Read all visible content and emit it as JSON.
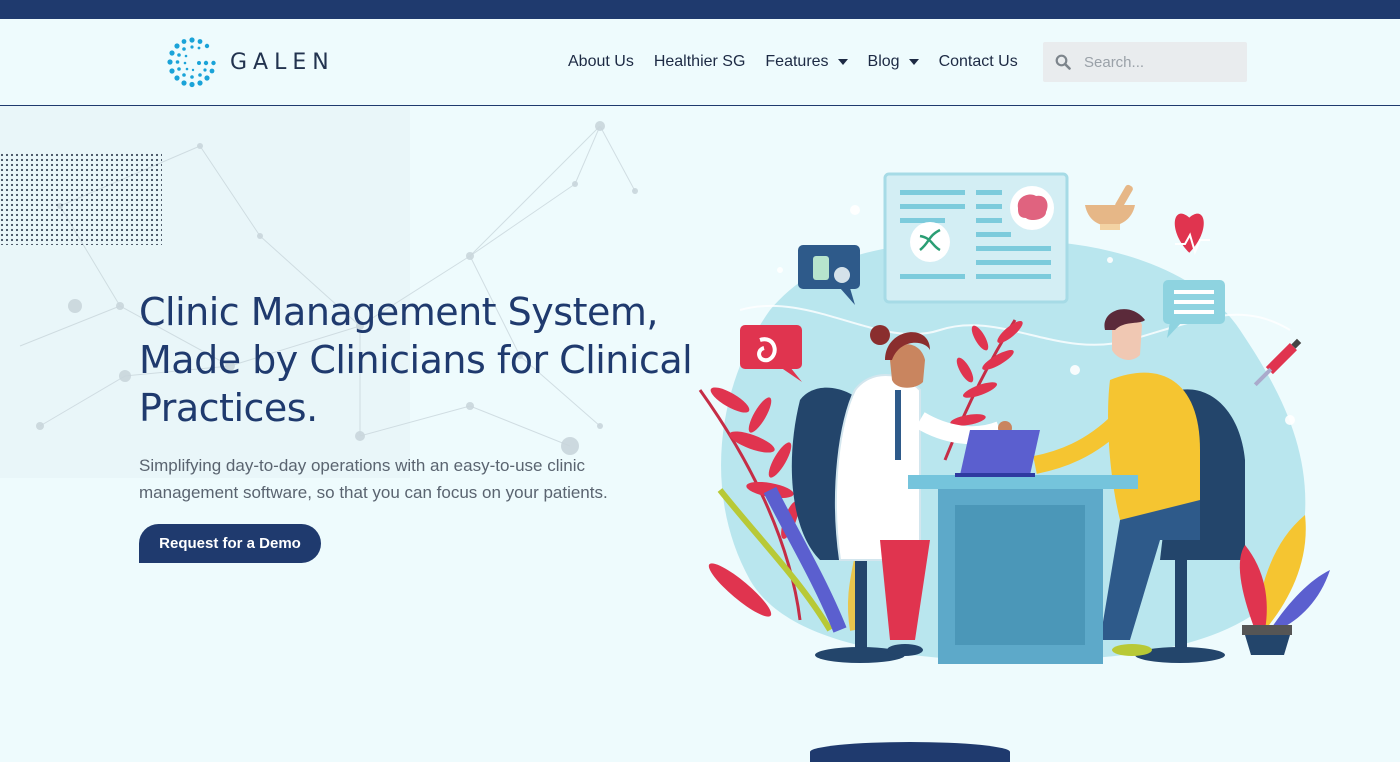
{
  "brand": {
    "name": "GALEN"
  },
  "nav": {
    "items": [
      {
        "label": "About Us",
        "dropdown": false
      },
      {
        "label": "Healthier SG",
        "dropdown": false
      },
      {
        "label": "Features",
        "dropdown": true
      },
      {
        "label": "Blog",
        "dropdown": true
      },
      {
        "label": "Contact Us",
        "dropdown": false
      }
    ]
  },
  "search": {
    "placeholder": "Search...",
    "icon": "search-icon"
  },
  "hero": {
    "title": "Clinic Management System, Made by Clinicians for Clinical Practices.",
    "subtitle": "Simplifying day-to-day operations with an easy-to-use clinic management software, so that you can focus on your patients.",
    "cta_label": "Request for a Demo"
  },
  "colors": {
    "primary": "#1f3a6e",
    "background": "#eefbfd",
    "accent_red": "#e0344f",
    "accent_yellow": "#f5c531"
  }
}
